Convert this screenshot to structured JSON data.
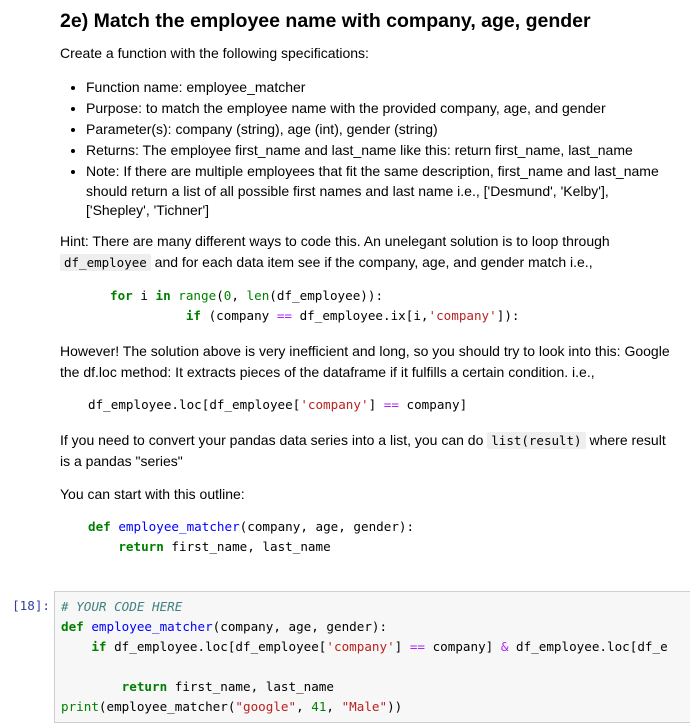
{
  "heading": "2e) Match the employee name with company, age, gender",
  "intro": "Create a function with the following specifications:",
  "bullets": [
    "Function name: employee_matcher",
    "Purpose: to match the employee name with the provided company, age, and gender",
    "Parameter(s): company (string), age (int), gender (string)",
    "Returns: The employee first_name and last_name like this: return first_name, last_name",
    "Note: If there are multiple employees that fit the same description, first_name and last_name should return a list of all possible first names and last name i.e., ['Desmund', 'Kelby'], ['Shepley', 'Tichner']"
  ],
  "hint": {
    "before": "Hint: There are many different ways to code this. An unelegant solution is to loop through ",
    "code": "df_employee",
    "after": " and for each data item see if the company, age, and gender match i.e.,"
  },
  "however": "However! The solution above is very inefficient and long, so you should try to look into this: Google the df.loc method: It extracts pieces of the dataframe if it fulfills a certain condition. i.e.,",
  "convert": {
    "before": "If you need to convert your pandas data series into a list, you can do ",
    "code": "list(result)",
    "after": " where result is a pandas \"series\""
  },
  "outline": "You can start with this outline:",
  "code_loop": [
    [
      [
        "kw",
        "for"
      ],
      [
        "",
        "      "
      ],
      [
        "kw",
        "i"
      ],
      [
        "",
        ""
      ]
    ],
    []
  ],
  "loop_lines": [
    [
      [
        "kw",
        "for "
      ],
      [
        "",
        "i "
      ],
      [
        "kw",
        "in "
      ],
      [
        "bi",
        "range"
      ],
      [
        "",
        "("
      ],
      [
        "nm",
        "0"
      ],
      [
        "",
        ", "
      ],
      [
        "bi",
        "len"
      ],
      [
        "",
        "(df_employee)):"
      ]
    ],
    [
      [
        "",
        "          "
      ],
      [
        "kw",
        "if "
      ],
      [
        "",
        "(company "
      ],
      [
        "op",
        "=="
      ],
      [
        "",
        " df_employee.ix[i,"
      ],
      [
        "st",
        "'company'"
      ],
      [
        "",
        "]):"
      ]
    ]
  ],
  "loc_lines": [
    [
      [
        "",
        "df_employee.loc[df_employee["
      ],
      [
        "st",
        "'company'"
      ],
      [
        "",
        "] "
      ],
      [
        "op",
        "=="
      ],
      [
        "",
        " company]"
      ]
    ]
  ],
  "outline_lines": [
    [
      [
        "kw",
        "def "
      ],
      [
        "fn",
        "employee_matcher"
      ],
      [
        "",
        "(company, age, gender):"
      ]
    ],
    [
      [
        "",
        "    "
      ],
      [
        "kw",
        "return "
      ],
      [
        "",
        "first_name, last_name"
      ]
    ]
  ],
  "cell": {
    "prompt": "[18]:",
    "lines": [
      [
        [
          "cm",
          "# YOUR CODE HERE"
        ]
      ],
      [
        [
          "kw",
          "def "
        ],
        [
          "fn",
          "employee_matcher"
        ],
        [
          "",
          "(company, age, gender):"
        ]
      ],
      [
        [
          "",
          "    "
        ],
        [
          "kw",
          "if "
        ],
        [
          "",
          "df_employee.loc[df_employee["
        ],
        [
          "st",
          "'company'"
        ],
        [
          "",
          "] "
        ],
        [
          "op",
          "=="
        ],
        [
          "",
          " company] "
        ],
        [
          "op",
          "&"
        ],
        [
          "",
          " df_employee.loc[df_e"
        ]
      ],
      [
        [
          "",
          ""
        ]
      ],
      [
        [
          "",
          "        "
        ],
        [
          "kw",
          "return "
        ],
        [
          "",
          "first_name, last_name"
        ]
      ],
      [
        [
          "bi",
          "print"
        ],
        [
          "",
          "(employee_matcher("
        ],
        [
          "st",
          "\"google\""
        ],
        [
          "",
          ", "
        ],
        [
          "nm",
          "41"
        ],
        [
          "",
          ", "
        ],
        [
          "st",
          "\"Male\""
        ],
        [
          "",
          "))"
        ]
      ]
    ]
  }
}
